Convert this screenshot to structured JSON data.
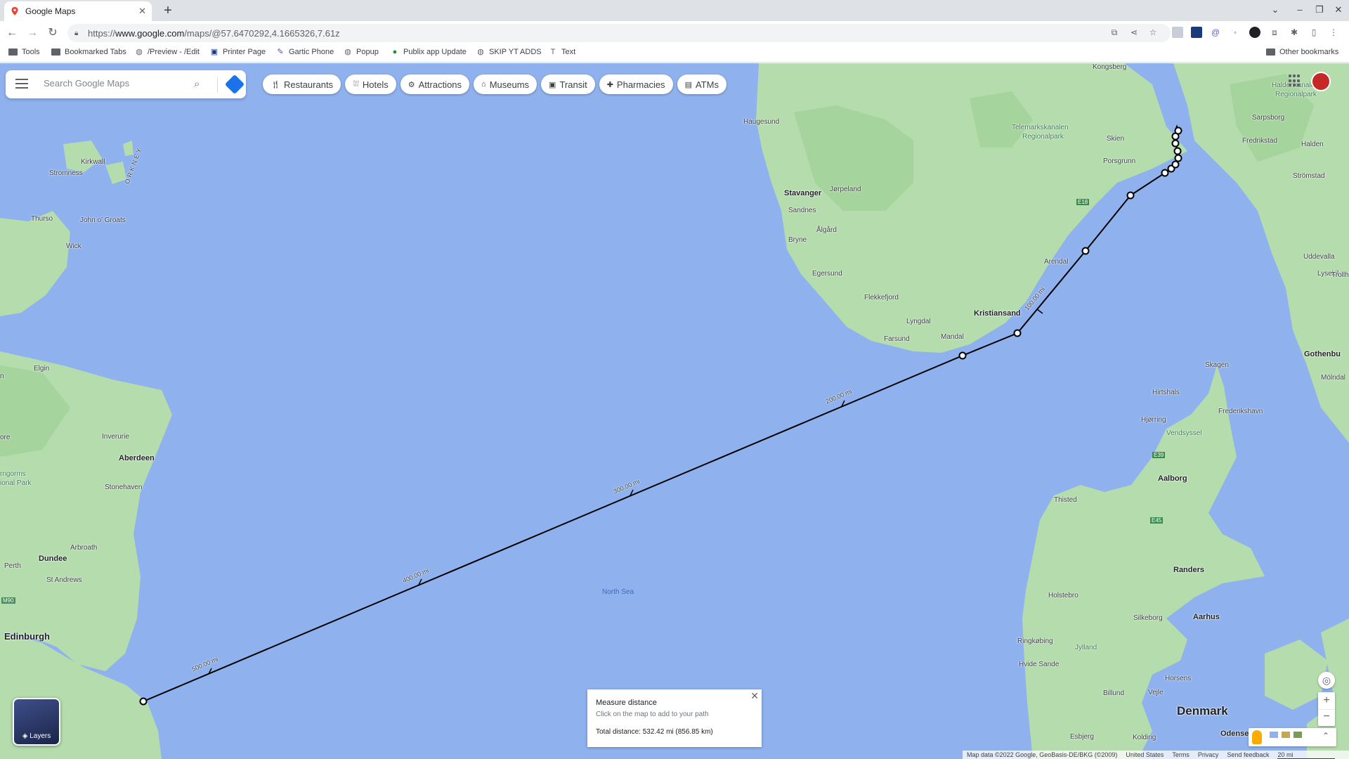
{
  "browser": {
    "tab_title": "Google Maps",
    "url_prefix": "https://",
    "url_host": "www.google.com",
    "url_path": "/maps/@57.6470292,4.1665326,7.61z",
    "bookmarks": [
      "Tools",
      "Bookmarked Tabs",
      "/Preview - /Edit",
      "Printer Page",
      "Gartic Phone",
      "Popup",
      "Publix app Update",
      "SKIP YT ADDS",
      "Text"
    ],
    "other_bookmarks": "Other bookmarks"
  },
  "search": {
    "placeholder": "Search Google Maps"
  },
  "chips": [
    "Restaurants",
    "Hotels",
    "Attractions",
    "Museums",
    "Transit",
    "Pharmacies",
    "ATMs"
  ],
  "map": {
    "water_color": "#8fb2ee",
    "land_color": "#b4dcad",
    "path_color": "#000000",
    "places": {
      "kongsberg": "Kongsberg",
      "haldenkanalen": "Haldenkanalen",
      "regionalpark": "Regionalpark",
      "sarpsborg": "Sarpsborg",
      "fredrikstad": "Fredrikstad",
      "halden": "Halden",
      "haugesund": "Haugesund",
      "telemark1": "Telemarkskanalen",
      "telemark2": "Regionalpark",
      "skien": "Skien",
      "porsgrunn": "Porsgrunn",
      "stromstad": "Strömstad",
      "stavanger": "Stavanger",
      "jorpeland": "Jørpeland",
      "sandnes": "Sandnes",
      "algard": "Ålgård",
      "bryne": "Bryne",
      "egersund": "Egersund",
      "arendal": "Arendal",
      "uddevalla": "Uddevalla",
      "lysekil": "Lysekil",
      "trollhattan": "Trollh",
      "flekkefjord": "Flekkefjord",
      "lyngdal": "Lyngdal",
      "kristiansand": "Kristiansand",
      "farsund": "Farsund",
      "mandal": "Mandal",
      "gothenburg": "Gothenbu",
      "molndal": "Mölndal",
      "skagen": "Skagen",
      "hirtshals": "Hirtshals",
      "frederikshavn": "Frederikshavn",
      "hjorring": "Hjørring",
      "vendsyssel": "Vendsyssel",
      "aalborg": "Aalborg",
      "thisted": "Thisted",
      "randers": "Randers",
      "holstebro": "Holstebro",
      "silkeborg": "Silkeborg",
      "aarhus": "Aarhus",
      "ringkobing": "Ringkøbing",
      "jylland": "Jylland",
      "hvide_sande": "Hvide Sande",
      "horsens": "Horsens",
      "billund": "Billund",
      "vejle": "Vejle",
      "denmark": "Denmark",
      "esbjerg": "Esbjerg",
      "kolding": "Kolding",
      "odense": "Odense",
      "north_sea": "North Sea",
      "kirkwall": "Kirkwall",
      "stromness": "Stromness",
      "orkney": "ORKNEY",
      "thurso": "Thurso",
      "john_o_groats": "John o' Groats",
      "wick": "Wick",
      "elgin": "Elgin",
      "inverurie": "Inverurie",
      "aberdeen": "Aberdeen",
      "stonehaven": "Stonehaven",
      "cairngorms1": "rngorms",
      "cairngorms2": "ional Park",
      "arbroath": "Arbroath",
      "dundee": "Dundee",
      "perth": "Perth",
      "st_andrews": "St Andrews",
      "edinburgh": "Edinburgh",
      "m90": "M90",
      "e18": "E18",
      "e45": "E45",
      "e39": "E39",
      "n_edge": "n",
      "ore": "ore"
    },
    "distance_labels": [
      "100.00 mi",
      "200.00 mi",
      "300.00 mi",
      "400.00 mi",
      "500.00 mi"
    ]
  },
  "measure": {
    "title": "Measure distance",
    "hint": "Click on the map to add to your path",
    "total": "Total distance: 532.42 mi (856.85 km)"
  },
  "layers_label": "Layers",
  "footer": {
    "data": "Map data ©2022 Google, GeoBasis-DE/BKG (©2009)",
    "region": "United States",
    "terms": "Terms",
    "privacy": "Privacy",
    "feedback": "Send feedback",
    "scale": "20 mi"
  }
}
